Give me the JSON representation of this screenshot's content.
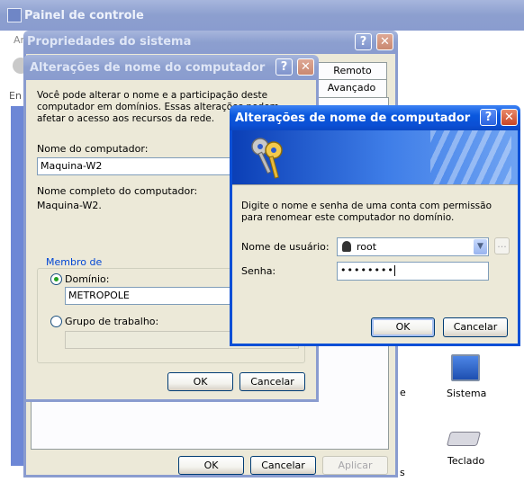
{
  "control_panel": {
    "title": "Painel de controle",
    "menu_fragment": "Ar",
    "side_fragment": "En",
    "items": [
      {
        "label": "Sistema",
        "icon": "system-icon"
      },
      {
        "label": "Teclado",
        "icon": "keyboard-icon"
      }
    ],
    "fragment_e": "e",
    "fragment_s": "s"
  },
  "system_properties": {
    "title": "Propriedades do sistema",
    "tabs": [
      "Remoto",
      "Avançado"
    ],
    "ok": "OK",
    "cancel": "Cancelar",
    "apply": "Aplicar"
  },
  "rename_dialog": {
    "title": "Alterações de nome do computador",
    "intro": "Você pode alterar o nome e a participação deste computador em domínios. Essas alterações podem afetar o acesso aos recursos da rede.",
    "computer_name_label": "Nome do computador:",
    "computer_name_value": "Maquina-W2",
    "full_name_label": "Nome completo do computador:",
    "full_name_value": "Maquina-W2.",
    "member_of_label": "Membro de",
    "domain_label": "Domínio:",
    "domain_value": "METROPOLE",
    "workgroup_label": "Grupo de trabalho:",
    "workgroup_value": "",
    "ok": "OK",
    "cancel": "Cancelar"
  },
  "credentials_dialog": {
    "title": "Alterações de nome de computador",
    "prompt": "Digite o nome e senha de uma conta com permissão para renomear este computador no domínio.",
    "user_label": "Nome de usuário:",
    "user_value": "root",
    "password_label": "Senha:",
    "password_value": "••••••••",
    "browse": "...",
    "ok": "OK",
    "cancel": "Cancelar"
  },
  "colors": {
    "xp_blue": "#0a58de",
    "inactive_title": "#8c9fcf",
    "dialog_face": "#ece9d8"
  }
}
